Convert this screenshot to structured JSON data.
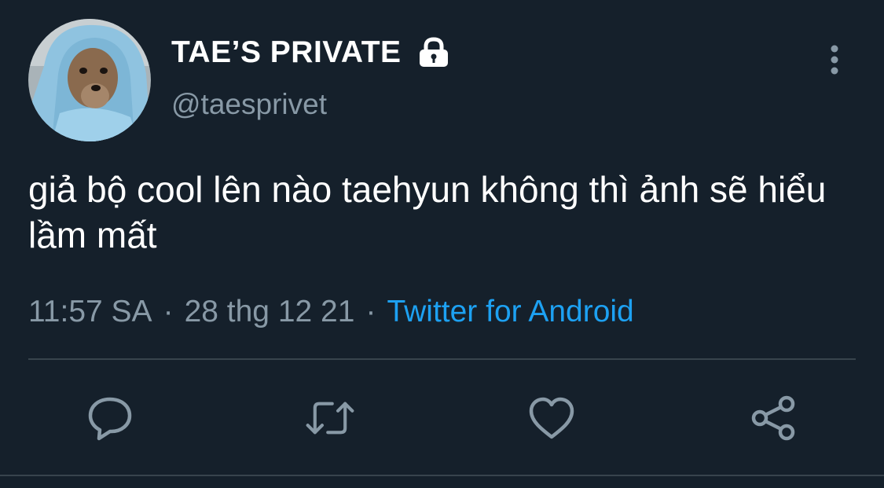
{
  "author": {
    "display_name": "TAE’S PRIVATE",
    "handle": "@taesprivet",
    "protected_icon": "lock-icon",
    "avatar": "avatar-dog-in-blue-hoodie"
  },
  "tweet": {
    "text": "giả bộ cool lên nào taehyun không thì ảnh sẽ hiểu lầm mất",
    "time": "11:57 SA",
    "separator": "·",
    "date": "28 thg 12 21",
    "source": "Twitter for Android"
  },
  "actions": [
    {
      "name": "reply",
      "icon": "reply-icon"
    },
    {
      "name": "retweet",
      "icon": "retweet-icon"
    },
    {
      "name": "like",
      "icon": "heart-icon"
    },
    {
      "name": "share",
      "icon": "share-icon"
    }
  ],
  "colors": {
    "background": "#15202b",
    "text_primary": "#ffffff",
    "text_secondary": "#8899a6",
    "accent": "#1da1f2",
    "divider": "#38444d"
  }
}
